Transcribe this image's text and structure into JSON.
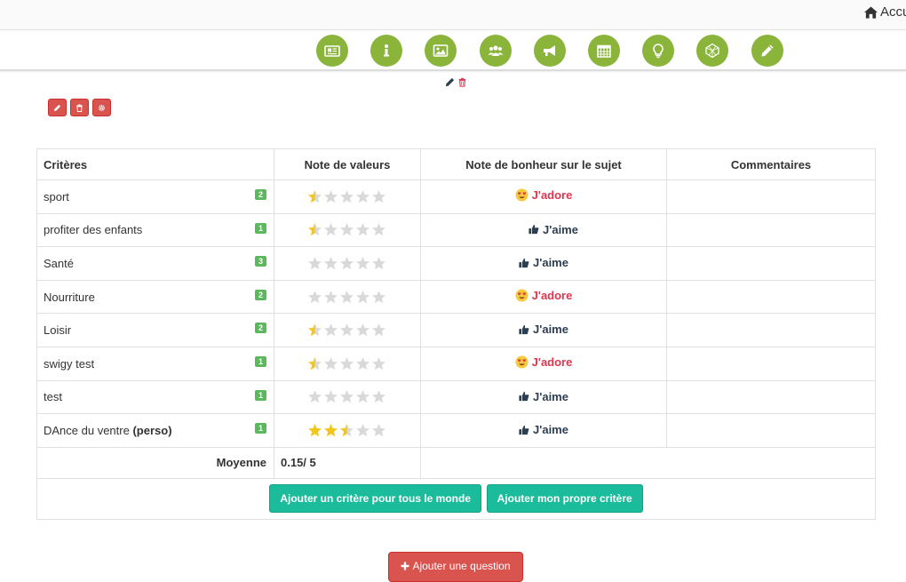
{
  "topbar": {
    "home_label": "Accueil",
    "home_icon": "home-icon"
  },
  "nav_icons": [
    "newspaper-icon",
    "info-icon",
    "image-icon",
    "users-icon",
    "bullhorn-icon",
    "calendar-icon",
    "lightbulb-icon",
    "globe-icon",
    "pencil-icon"
  ],
  "colors": {
    "nav_green": "#8ab43a",
    "danger": "#d9534f",
    "success": "#5cb85c",
    "teal": "#1abc9c",
    "adore": "#e0364f",
    "star": "#f5c518"
  },
  "table": {
    "headers": {
      "criteria": "Critères",
      "values": "Note de valeurs",
      "happiness": "Note de bonheur sur le sujet",
      "comments": "Commentaires"
    },
    "rows": [
      {
        "name": "sport",
        "suffix": "",
        "badge": "2",
        "stars": 0.5,
        "mood": "J'adore",
        "mood_type": "adore"
      },
      {
        "name": "profiter des enfants",
        "suffix": "",
        "badge": "1",
        "stars": 0.5,
        "mood": "J'aime",
        "mood_type": "aime"
      },
      {
        "name": "Santé",
        "suffix": "",
        "badge": "3",
        "stars": 0,
        "mood": "J'aime",
        "mood_type": "aime"
      },
      {
        "name": "Nourriture",
        "suffix": "",
        "badge": "2",
        "stars": 0,
        "mood": "J'adore",
        "mood_type": "adore"
      },
      {
        "name": "Loisir",
        "suffix": "",
        "badge": "2",
        "stars": 0.5,
        "mood": "J'aime",
        "mood_type": "aime"
      },
      {
        "name": "swigy test",
        "suffix": "",
        "badge": "1",
        "stars": 0.5,
        "mood": "J'adore",
        "mood_type": "adore"
      },
      {
        "name": "test",
        "suffix": "",
        "badge": "1",
        "stars": 0,
        "mood": "J'aime",
        "mood_type": "aime"
      },
      {
        "name": "DAnce du ventre",
        "suffix": "(perso)",
        "badge": "1",
        "stars": 2.5,
        "mood": "J'aime",
        "mood_type": "aime"
      }
    ],
    "average_label": "Moyenne",
    "average_value": "0.15/ 5",
    "add_all_label": "Ajouter un critère pour tous le monde",
    "add_own_label": "Ajouter mon propre critère"
  },
  "add_question_label": "Ajouter une question"
}
